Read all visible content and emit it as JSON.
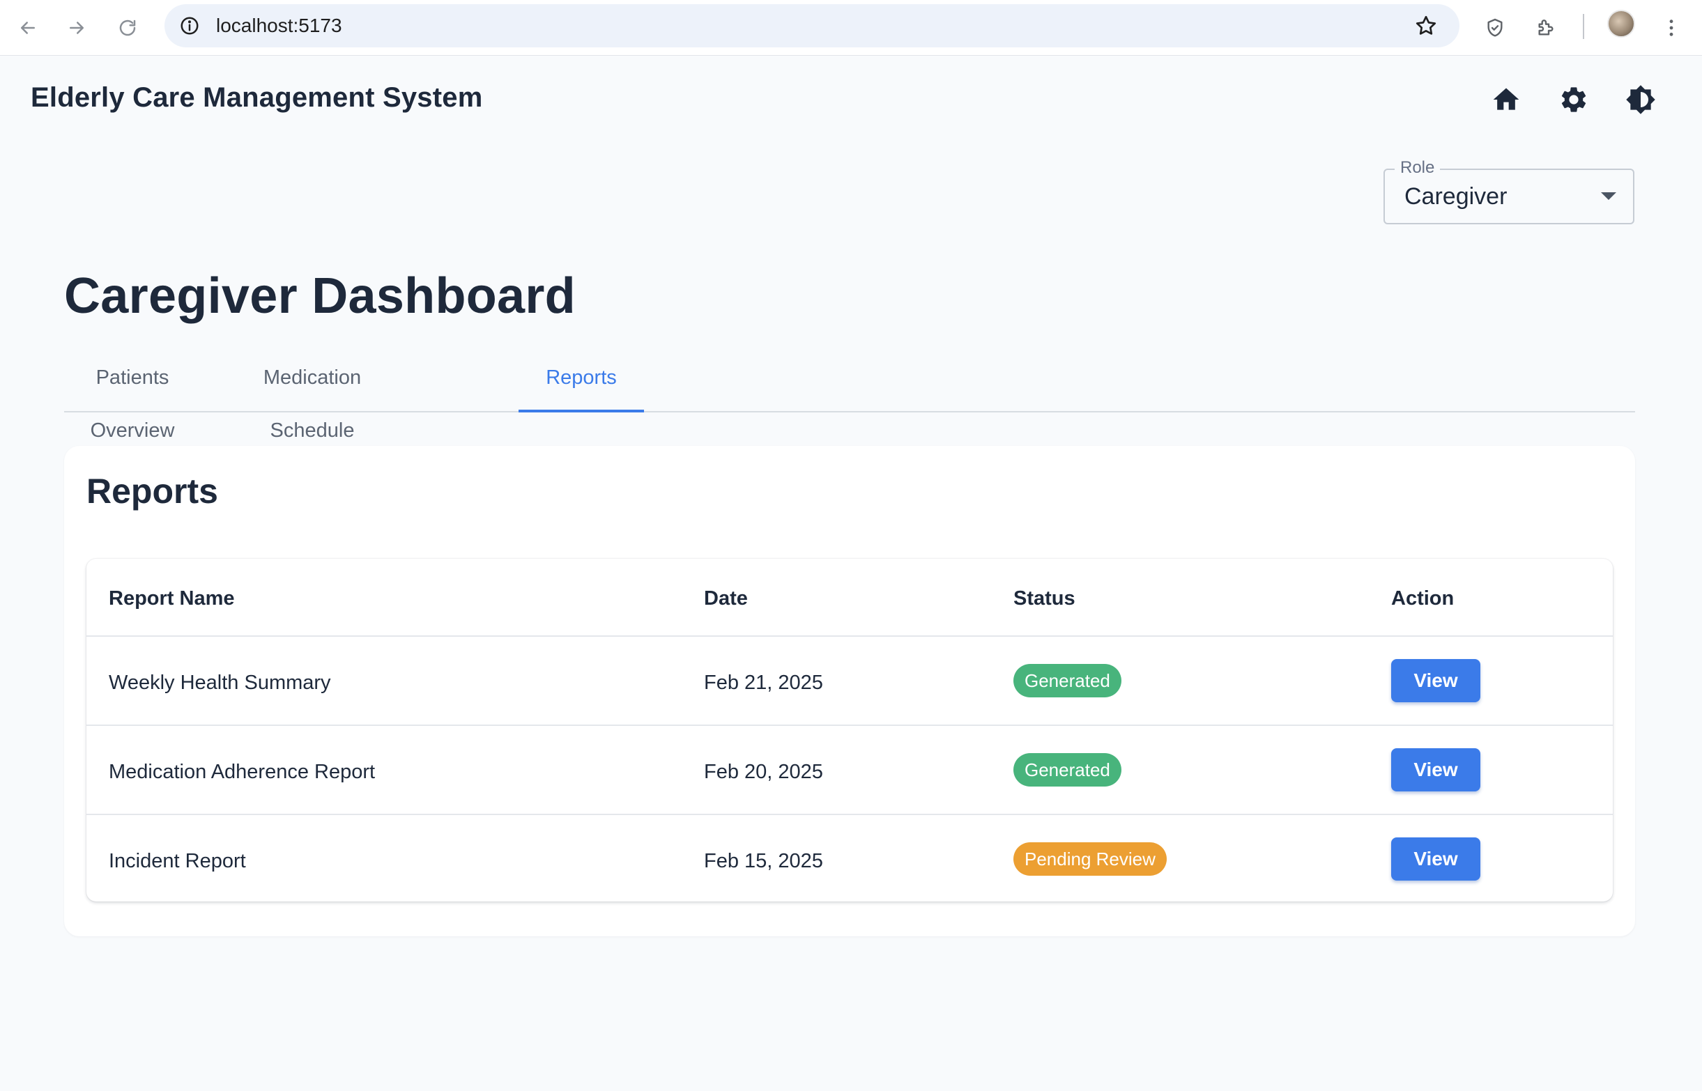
{
  "browser": {
    "url": "localhost:5173",
    "icons": [
      "back-arrow-icon",
      "forward-arrow-icon",
      "reload-icon",
      "info-icon",
      "bookmark-star-icon",
      "shield-icon",
      "extensions-icon",
      "profile-avatar",
      "more-vert-icon"
    ]
  },
  "header": {
    "title": "Elderly Care Management System",
    "icons": [
      "home-icon",
      "settings-gear-icon",
      "theme-toggle-icon"
    ]
  },
  "role_select": {
    "label": "Role",
    "value": "Caregiver"
  },
  "page": {
    "title": "Caregiver Dashboard"
  },
  "tabs": [
    {
      "label": "Patients Overview",
      "active": false
    },
    {
      "label": "Medication Schedule",
      "active": false
    },
    {
      "label": "Reports",
      "active": true
    }
  ],
  "reports": {
    "title": "Reports",
    "columns": [
      "Report Name",
      "Date",
      "Status",
      "Action"
    ],
    "rows": [
      {
        "name": "Weekly Health Summary",
        "date": "Feb 21, 2025",
        "status": "Generated",
        "action": "View"
      },
      {
        "name": "Medication Adherence Report",
        "date": "Feb 20, 2025",
        "status": "Generated",
        "action": "View"
      },
      {
        "name": "Incident Report",
        "date": "Feb 15, 2025",
        "status": "Pending Review",
        "action": "View"
      }
    ]
  },
  "colors": {
    "accent": "#3b7be9",
    "status_generated": "#48b47c",
    "status_pending": "#ec9f32",
    "background": "#f8fafc"
  }
}
